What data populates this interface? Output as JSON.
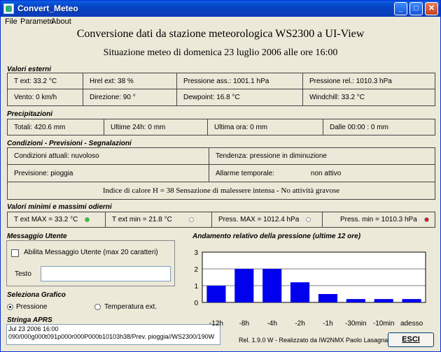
{
  "window": {
    "title": "Convert_Meteo"
  },
  "titlebar": {
    "min": "_",
    "max": "□",
    "close": "✕"
  },
  "menu": [
    "File",
    "Parametri",
    "About"
  ],
  "header": {
    "title": "Conversione dati da stazione meteorologica WS2300 a UI-View",
    "subtitle": "Situazione meteo di  domenica  23 luglio 2006  alle ore 16:00"
  },
  "esterni": {
    "title": "Valori esterni",
    "t_ext": "T ext:  33.2 °C",
    "hrel": "Hrel ext:  38 %",
    "press_ass": "Pressione ass.:  1001.1 hPa",
    "press_rel": "Pressione rel.:  1010.3 hPa",
    "vento": "Vento:  0 km/h",
    "direzione": "Direzione:  90 °",
    "dewpoint": "Dewpoint:  16.8 °C",
    "windchill": "Windchill:  33.2 °C"
  },
  "precipitazioni": {
    "title": "Precipitazioni",
    "totali": "Totali:  420.6 mm",
    "ultime24": "Ultime 24h:  0 mm",
    "ultima_ora": "Ultima ora:  0 mm",
    "dalle": "Dalle 00:00 :  0 mm"
  },
  "condizioni": {
    "title": "Condizioni - Previsioni - Segnalazioni",
    "attuali": "Condizioni attuali:  nuvoloso",
    "tendenza": "Tendenza:   pressione in diminuzione",
    "previsione": "Previsione:  pioggia",
    "allarme_label": "Allarme temporale:",
    "allarme_value": "non attivo",
    "indice": "Indice di calore H = 38   Sensazione di malessere intensa - No attività gravose"
  },
  "minmax": {
    "title": "Valori minimi e massimi odierni",
    "t_max": "T ext MAX =  33.2 °C",
    "t_min": "T ext min =  21.8 °C",
    "p_max": "Press. MAX =  1012.4 hPa",
    "p_min": "Press. min =  1010.3 hPa",
    "colors": {
      "t_max": "#22cc22",
      "t_min": "#ffffff",
      "p_max": "#ffffff",
      "p_min": "#dd1111"
    }
  },
  "messaggio": {
    "title": "Messaggio Utente",
    "checkbox_label": "Abilita Messaggio Utente (max 20 caratteri)",
    "testo_label": "Testo",
    "testo_value": ""
  },
  "grafico": {
    "title": "Seleziona Grafico",
    "opt_pressione": "Pressione",
    "opt_temperatura": "Temperatura ext."
  },
  "aprs": {
    "title": "Stringa APRS",
    "line1": "Jul 23 2006 16:00",
    "line2": "090/000g000t091p000r000P000b10103h38/Prev. pioggia//WS2300/190W"
  },
  "footer": {
    "credits": "Rel. 1.9.0 W  -  Realizzato da IW2NMX   Paolo Lasagna",
    "esci": "ESCI"
  },
  "chart_data": {
    "type": "bar",
    "title": "Andamento relativo della pressione (ultime 12 ore)",
    "categories": [
      "-12h",
      "-8h",
      "-4h",
      "-2h",
      "-1h",
      "-30min",
      "-10min",
      "adesso"
    ],
    "values": [
      1.0,
      2.0,
      2.0,
      1.2,
      0.5,
      0.2,
      0.2,
      0.2
    ],
    "yticks": [
      "0",
      "1",
      "2",
      "3"
    ],
    "ylim": [
      0,
      3
    ],
    "bar_color": "#0000ee"
  }
}
